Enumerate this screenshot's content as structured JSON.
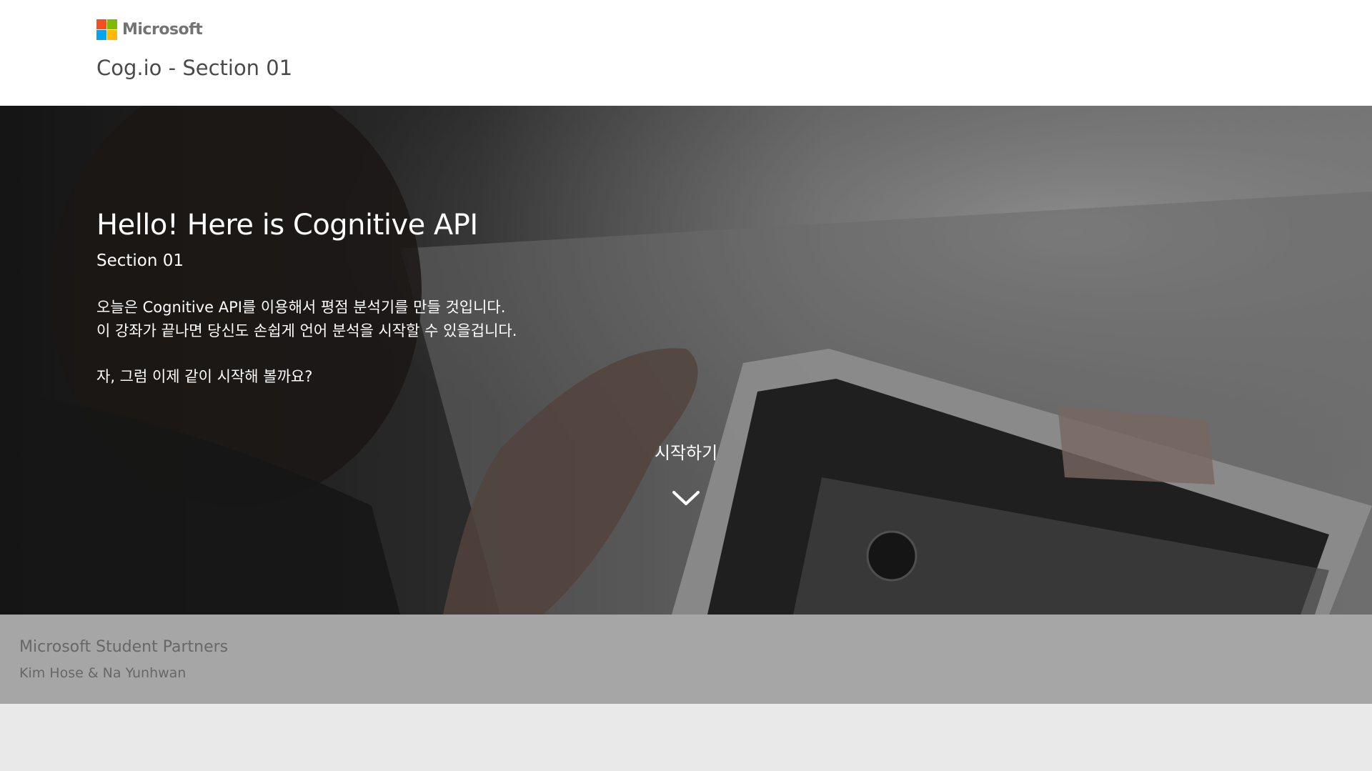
{
  "header": {
    "brand": "Microsoft",
    "site_title": "Cog.io - Section 01",
    "logo_colors": [
      "#f25022",
      "#7fba00",
      "#00a4ef",
      "#ffb900"
    ]
  },
  "hero": {
    "title": "Hello! Here is Cognitive API",
    "subtitle": "Section 01",
    "desc_line1": "오늘은 Cognitive API를 이용해서 평점 분석기를 만들 것입니다.",
    "desc_line2": "이 강좌가 끝나면 당신도 손쉽게 언어 분석을 시작할 수 있을겁니다.",
    "question": "자, 그럼 이제 같이 시작해 볼까요?",
    "start_label": "시작하기",
    "start_icon": "chevron-down-icon"
  },
  "footer": {
    "org": "Microsoft Student Partners",
    "authors": "Kim Hose & Na Yunhwan",
    "background": "#a6a6a6"
  }
}
